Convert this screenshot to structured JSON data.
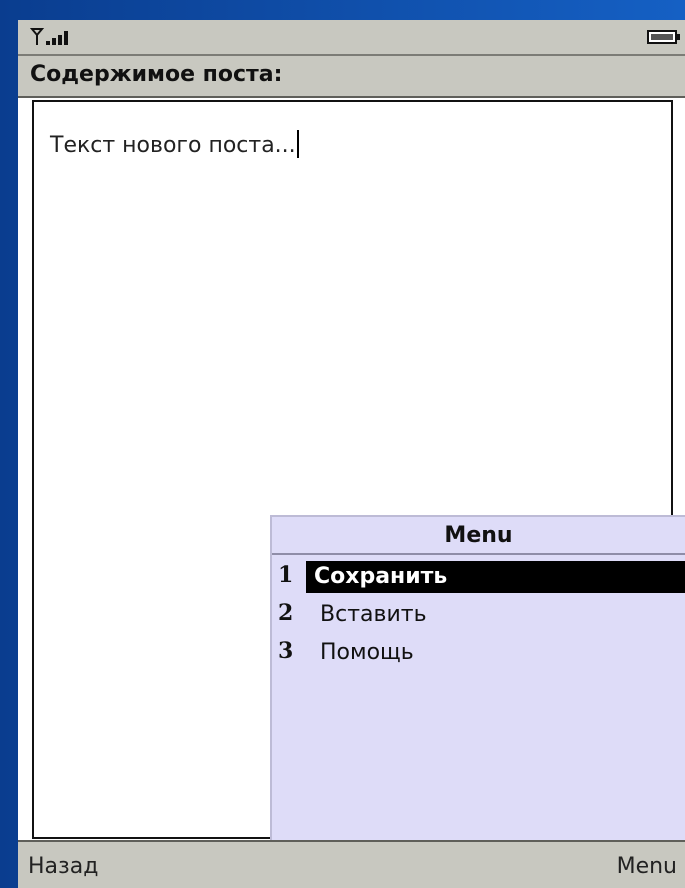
{
  "status": {
    "signal_icon": "signal-strength-icon",
    "battery_icon": "battery-icon"
  },
  "header": {
    "title": "Содержимое поста:"
  },
  "editor": {
    "text": "Текст нового поста..."
  },
  "menu": {
    "title": "Menu",
    "items": [
      {
        "number": "1",
        "label": "Сохранить",
        "selected": true
      },
      {
        "number": "2",
        "label": "Вставить",
        "selected": false
      },
      {
        "number": "3",
        "label": "Помощь",
        "selected": false
      }
    ]
  },
  "softkeys": {
    "left": "Назад",
    "right": "Menu"
  },
  "colors": {
    "background": "#1560c4",
    "bar": "#c8c8c0",
    "menu_bg": "#dedcf8",
    "selection": "#000000"
  }
}
